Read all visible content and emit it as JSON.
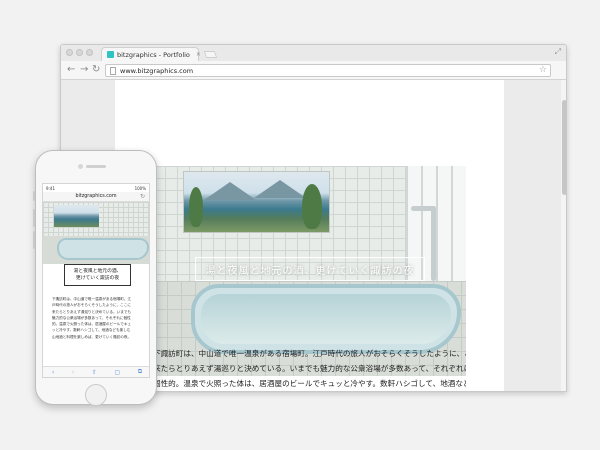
{
  "browser": {
    "tab_title": "bitzgraphics - Portfolio",
    "tab_close": "×",
    "url": "www.bitzgraphics.com",
    "nav_back": "←",
    "nav_forward": "→",
    "nav_reload": "↻",
    "bookmark": "☆",
    "resize": "⤢",
    "hero_caption": "湯と夜風と地元の酒、更けていく諏訪の夜",
    "body_lines": [
      "下諏訪町は、中山道で唯一温泉がある宿場町。江戸時代の旅人がおそらくそうしたように、ここ",
      "来たらとりあえず湯巡りと決めている。いまでも魅力的な公衆浴場が多数あって、それぞれに",
      "個性的。温泉で火照った体は、居酒屋のビールでキュッと冷やす。数軒ハシゴして、地酒なども"
    ]
  },
  "phone": {
    "time": "9:41",
    "battery": "100%",
    "url": "bitzgraphics.com",
    "reload": "↻",
    "caption_line1": "湯と夜風と地元の酒、",
    "caption_line2": "更けていく諏訪の夜",
    "body_lines": [
      "下諏訪町は、中山道で唯一温泉がある宿場町。江",
      "戸時代の旅人がおそらくそうしたように、ここに",
      "来たらとりあえず湯巡りと決めている。いまでも",
      "魅力的な公衆浴場が多数あって、それぞれに個性",
      "的。温泉で火照った体は、居酒屋のビールでキュ",
      "ッと冷やす。数軒ハシゴして、地酒なども楽しむ",
      "山地酒と料理を楽しめば、更けていく諏訪の夜。"
    ],
    "toolbar": {
      "back": "‹",
      "forward": "›",
      "share": "⇧",
      "bookmarks": "▢",
      "tabs": "⧉"
    }
  },
  "colors": {
    "background": "#f2f2f2",
    "favicon": "#2ec4c4",
    "ios_tint": "#5a8fd6"
  }
}
